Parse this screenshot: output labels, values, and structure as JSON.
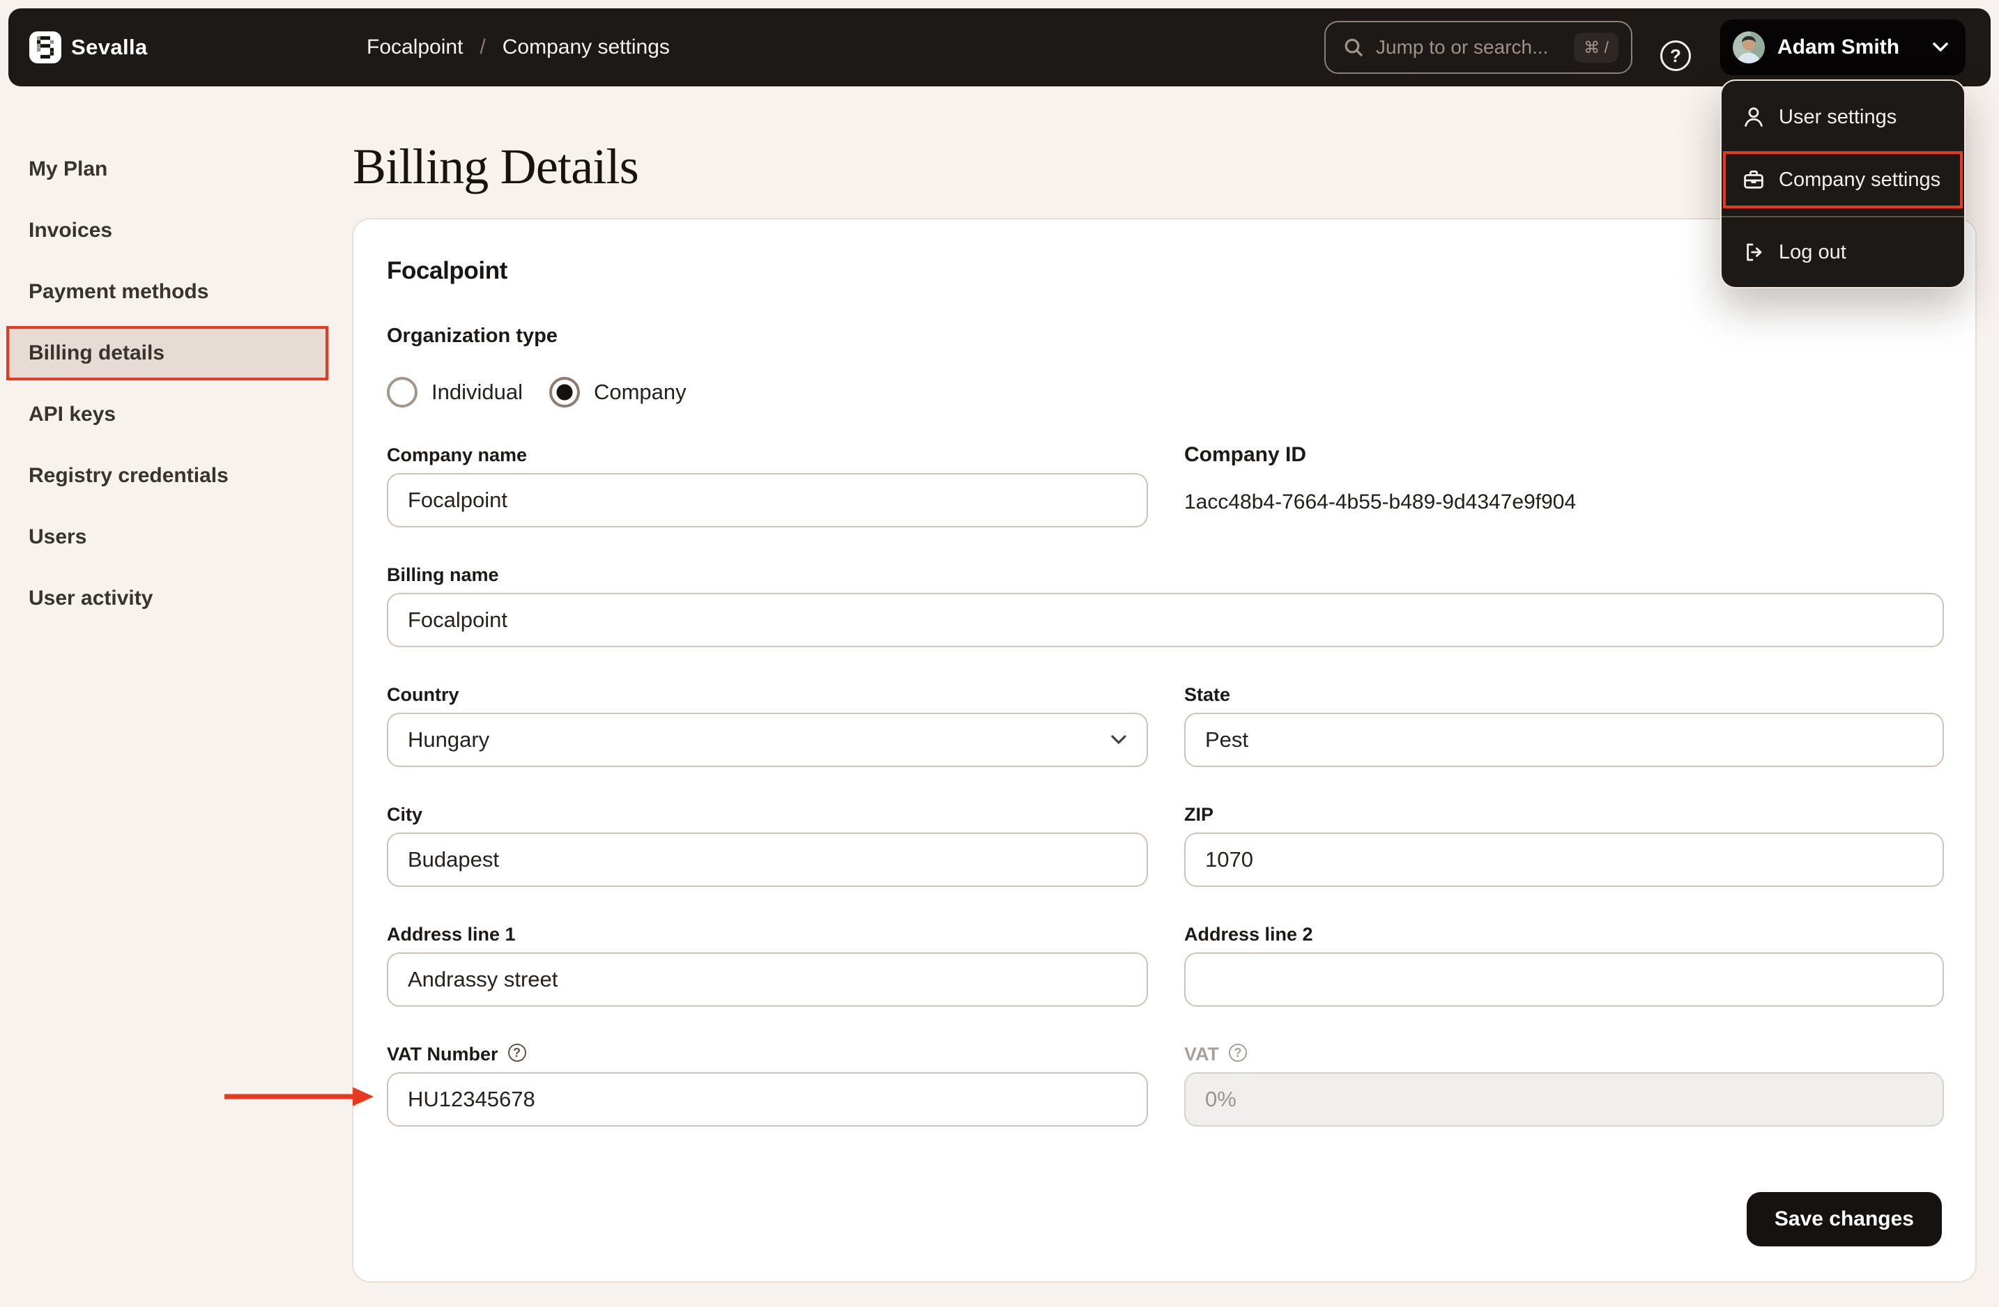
{
  "navbar": {
    "brand": "Sevalla",
    "breadcrumb": {
      "org": "Focalpoint",
      "separator": "/",
      "page": "Company settings"
    },
    "search": {
      "placeholder": "Jump to or search...",
      "shortcut": "⌘ /"
    },
    "help_label": "?",
    "user": {
      "name": "Adam Smith"
    }
  },
  "user_menu": {
    "items": [
      {
        "label": "User settings"
      },
      {
        "label": "Company settings"
      },
      {
        "label": "Log out"
      }
    ]
  },
  "sidebar": {
    "items": [
      {
        "label": "My Plan"
      },
      {
        "label": "Invoices"
      },
      {
        "label": "Payment methods"
      },
      {
        "label": "Billing details"
      },
      {
        "label": "API keys"
      },
      {
        "label": "Registry credentials"
      },
      {
        "label": "Users"
      },
      {
        "label": "User activity"
      }
    ]
  },
  "page": {
    "title": "Billing Details"
  },
  "card": {
    "company_title": "Focalpoint",
    "organization_type": {
      "label": "Organization type",
      "options": [
        {
          "label": "Individual",
          "selected": false
        },
        {
          "label": "Company",
          "selected": true
        }
      ]
    },
    "fields": {
      "company_name": {
        "label": "Company name",
        "value": "Focalpoint"
      },
      "company_id": {
        "label": "Company ID",
        "value": "1acc48b4-7664-4b55-b489-9d4347e9f904"
      },
      "billing_name": {
        "label": "Billing name",
        "value": "Focalpoint"
      },
      "country": {
        "label": "Country",
        "value": "Hungary"
      },
      "state": {
        "label": "State",
        "value": "Pest"
      },
      "city": {
        "label": "City",
        "value": "Budapest"
      },
      "zip": {
        "label": "ZIP",
        "value": "1070"
      },
      "address1": {
        "label": "Address line 1",
        "value": "Andrassy street"
      },
      "address2": {
        "label": "Address line 2",
        "value": ""
      },
      "vat_number": {
        "label": "VAT Number",
        "value": "HU12345678"
      },
      "vat": {
        "label": "VAT",
        "value": "0%"
      }
    },
    "save_label": "Save changes"
  },
  "colors": {
    "annotation": "#e7391d",
    "active_item_bg": "#e7dcd4",
    "navbar_bg": "#1c1917",
    "page_bg": "#f7f2ee"
  }
}
